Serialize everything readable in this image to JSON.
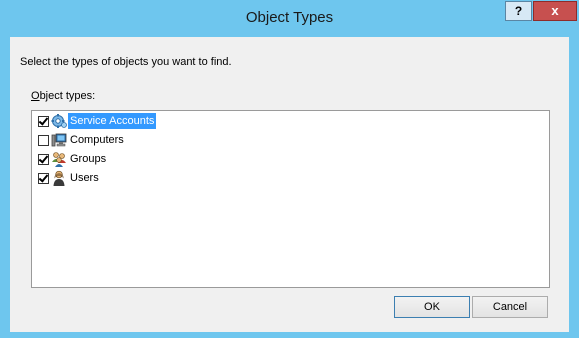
{
  "window": {
    "title": "Object Types",
    "help_label": "?",
    "close_label": "x"
  },
  "dialog": {
    "instruction": "Select the types of objects you want to find.",
    "list_label_accel": "O",
    "list_label_rest": "bject types:",
    "items": [
      {
        "label": "Service Accounts",
        "checked": true,
        "selected": true,
        "icon": "service-accounts-icon"
      },
      {
        "label": "Computers",
        "checked": false,
        "selected": false,
        "icon": "computer-icon"
      },
      {
        "label": "Groups",
        "checked": true,
        "selected": false,
        "icon": "groups-icon"
      },
      {
        "label": "Users",
        "checked": true,
        "selected": false,
        "icon": "user-icon"
      }
    ],
    "ok_label": "OK",
    "cancel_label": "Cancel"
  },
  "colors": {
    "frame": "#6ec6ee",
    "selection": "#3399ff",
    "close_button": "#c7504f"
  }
}
